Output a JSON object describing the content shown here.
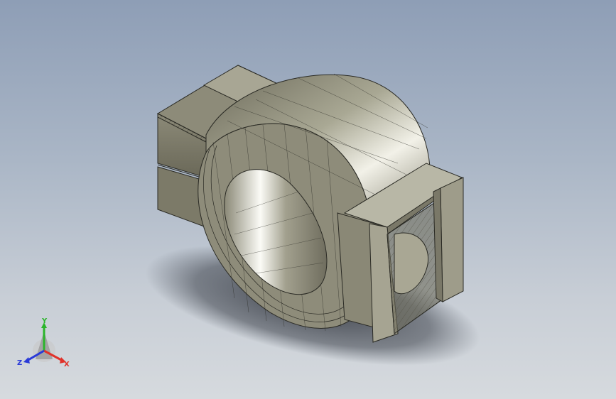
{
  "viewport": {
    "background_top": "#8e9eb6",
    "background_bottom": "#d6dade"
  },
  "model": {
    "part": "clamp-with-ring-and-tabs",
    "face_color": "#9a9886",
    "edge_color": "#2a2a24"
  },
  "triad": {
    "x_label": "X",
    "y_label": "Y",
    "z_label": "Z",
    "x_color": "#e0322a",
    "y_color": "#2bb52b",
    "z_color": "#2a3ad8"
  }
}
